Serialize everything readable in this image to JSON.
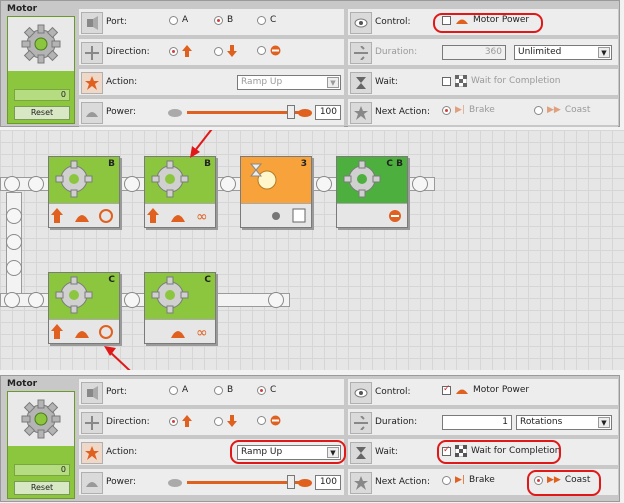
{
  "top_panel": {
    "title": "Motor",
    "counter": "0",
    "reset_label": "Reset",
    "port": {
      "label": "Port:",
      "options": [
        "A",
        "B",
        "C"
      ],
      "selected": "B"
    },
    "direction": {
      "label": "Direction:"
    },
    "action": {
      "label": "Action:",
      "value": "Ramp Up",
      "disabled": true
    },
    "power": {
      "label": "Power:",
      "value": "100",
      "level": 1.0
    },
    "control": {
      "label": "Control:",
      "option": "Motor Power",
      "checked": false
    },
    "duration": {
      "label": "Duration:",
      "value": "360",
      "unit": "Unlimited",
      "disabled": true
    },
    "wait": {
      "label": "Wait:",
      "option": "Wait for Completion",
      "checked": false,
      "disabled": true
    },
    "next_action": {
      "label": "Next Action:",
      "options": [
        "Brake",
        "Coast"
      ],
      "disabled": true
    }
  },
  "program": {
    "blocks": [
      {
        "type": "motor",
        "port": "B"
      },
      {
        "type": "motor",
        "port": "B"
      },
      {
        "type": "timer",
        "label": "3"
      },
      {
        "type": "move",
        "port": "C B"
      },
      {
        "type": "motor",
        "port": "C"
      },
      {
        "type": "motor",
        "port": "C"
      }
    ]
  },
  "bottom_panel": {
    "title": "Motor",
    "counter": "0",
    "reset_label": "Reset",
    "port": {
      "label": "Port:",
      "options": [
        "A",
        "B",
        "C"
      ],
      "selected": "C"
    },
    "direction": {
      "label": "Direction:"
    },
    "action": {
      "label": "Action:",
      "value": "Ramp Up",
      "disabled": false
    },
    "power": {
      "label": "Power:",
      "value": "100",
      "level": 1.0
    },
    "control": {
      "label": "Control:",
      "option": "Motor Power",
      "checked": true
    },
    "duration": {
      "label": "Duration:",
      "value": "1",
      "unit": "Rotations",
      "disabled": false
    },
    "wait": {
      "label": "Wait:",
      "option": "Wait for Completion",
      "checked": true
    },
    "next_action": {
      "label": "Next Action:",
      "options": [
        "Brake",
        "Coast"
      ],
      "selected": "Coast"
    }
  },
  "colors": {
    "accent": "#e06020",
    "highlight": "#e01818",
    "block_green": "#8cc63f",
    "timer_orange": "#f7a23a"
  }
}
